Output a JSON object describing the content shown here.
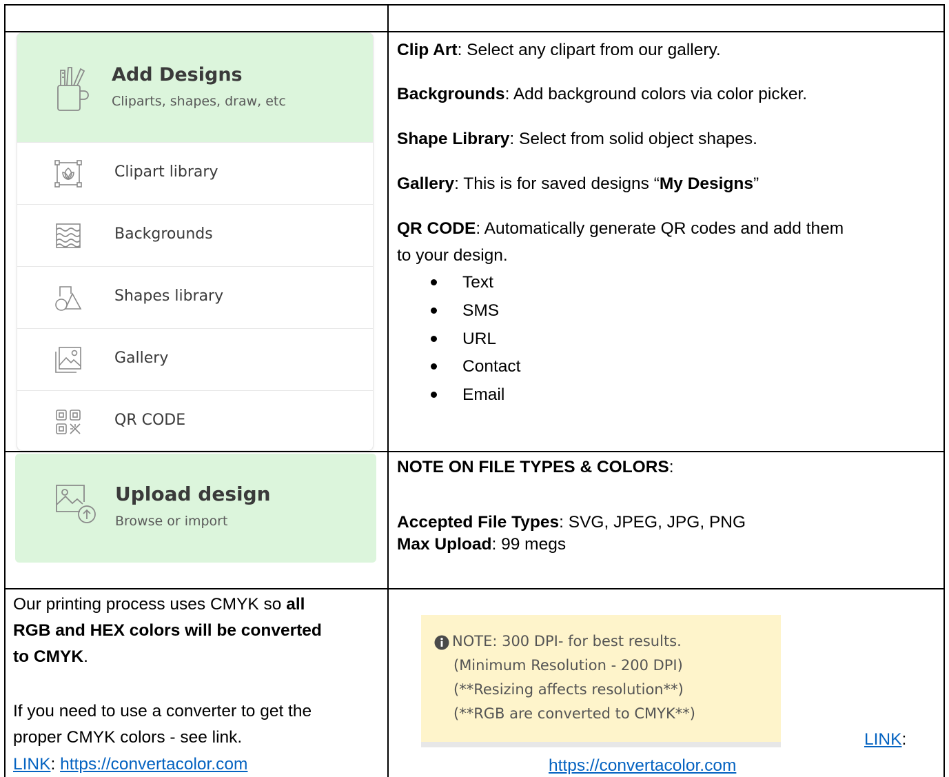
{
  "add_designs_panel": {
    "header": {
      "icon": "pencil-cup-icon",
      "title": "Add Designs",
      "subtitle": "Cliparts, shapes, draw, etc"
    },
    "items": [
      {
        "label": "Clipart library",
        "icon": "clipart-frame-icon"
      },
      {
        "label": "Backgrounds",
        "icon": "background-pattern-icon"
      },
      {
        "label": "Shapes library",
        "icon": "shapes-icon"
      },
      {
        "label": "Gallery",
        "icon": "image-gallery-icon"
      },
      {
        "label": "QR CODE",
        "icon": "qr-code-icon"
      }
    ],
    "colors": {
      "header_bg": "#dcf5dc",
      "text": "#3a3a3a",
      "subtext": "#5a5a5a"
    }
  },
  "descriptions": [
    {
      "term": "Clip Art",
      "text": ": Select any clipart from our gallery."
    },
    {
      "term": "Backgrounds",
      "text": ": Add background colors via color picker."
    },
    {
      "term": "Shape Library",
      "text": ": Select from solid object shapes."
    },
    {
      "term": "Gallery",
      "text_before": ": This is for saved designs “",
      "text_bold": "My Designs",
      "text_after": "”"
    },
    {
      "term": "QR CODE",
      "text": ": Automatically generate QR codes and add them",
      "text_line2": "to your design."
    }
  ],
  "qr_types": [
    "Text",
    "SMS",
    "URL",
    "Contact",
    "Email"
  ],
  "upload_panel": {
    "icon": "upload-image-icon",
    "title": "Upload design",
    "subtitle": "Browse or import"
  },
  "file_note": {
    "heading": "NOTE ON FILE TYPES & COLORS",
    "heading_suffix": ":",
    "accepted_label": "Accepted File Types",
    "accepted_value": ": SVG, JPEG, JPG, PNG",
    "max_label": "Max Upload",
    "max_value": ": 99 megs"
  },
  "cmyk_note": {
    "line1": "Our printing process uses CMYK so ",
    "line1_bold": "all",
    "line2_bold": "RGB and HEX colors will be converted",
    "line3_bold": "to CMYK",
    "line3_after": ".",
    "line4": "If you need to use a converter to get the",
    "line5": "proper CMYK colors -  see link.",
    "link_label": "LINK",
    "link_sep": ": ",
    "url": "https://convertacolor.com"
  },
  "dpi_note": {
    "icon": "info-circle-icon",
    "lines": [
      "NOTE: 300 DPI- for best results.",
      "(Minimum Resolution - 200 DPI)",
      "(**Resizing affects resolution**)",
      "(**RGB are converted to CMYK**)"
    ],
    "bg_color": "#fef4cb",
    "link_label": "LINK",
    "link_sep": ":",
    "url": "https://convertacolor.com"
  },
  "colors": {
    "link": "#0563c1",
    "border": "#000000"
  }
}
